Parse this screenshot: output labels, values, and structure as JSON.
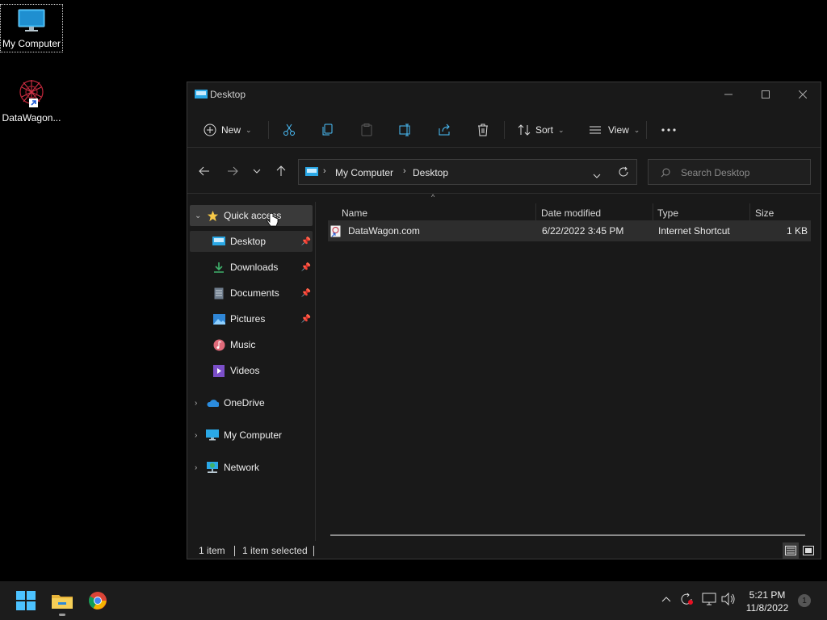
{
  "desktop": {
    "icons": [
      {
        "label": "My Computer"
      },
      {
        "label": "DataWagon..."
      }
    ]
  },
  "window": {
    "title": "Desktop",
    "toolbar": {
      "new_label": "New",
      "sort_label": "Sort",
      "view_label": "View"
    },
    "address": {
      "crumbs": [
        "My Computer",
        "Desktop"
      ]
    },
    "search": {
      "placeholder": "Search Desktop"
    },
    "navpane": {
      "quick_access": "Quick access",
      "items": [
        {
          "label": "Desktop",
          "pinned": true
        },
        {
          "label": "Downloads",
          "pinned": true
        },
        {
          "label": "Documents",
          "pinned": true
        },
        {
          "label": "Pictures",
          "pinned": true
        },
        {
          "label": "Music",
          "pinned": false
        },
        {
          "label": "Videos",
          "pinned": false
        }
      ],
      "roots": [
        {
          "label": "OneDrive"
        },
        {
          "label": "My Computer"
        },
        {
          "label": "Network"
        }
      ]
    },
    "columns": {
      "name": "Name",
      "date": "Date modified",
      "type": "Type",
      "size": "Size"
    },
    "files": [
      {
        "name": "DataWagon.com",
        "date": "6/22/2022 3:45 PM",
        "type": "Internet Shortcut",
        "size": "1 KB"
      }
    ],
    "status": {
      "count": "1 item",
      "selected": "1 item selected"
    }
  },
  "taskbar": {
    "time": "5:21 PM",
    "date": "11/8/2022",
    "notifications": "1"
  },
  "colors": {
    "accent": "#4cc2ff",
    "window_bg": "#191919",
    "taskbar_bg": "#1c1c1c"
  }
}
